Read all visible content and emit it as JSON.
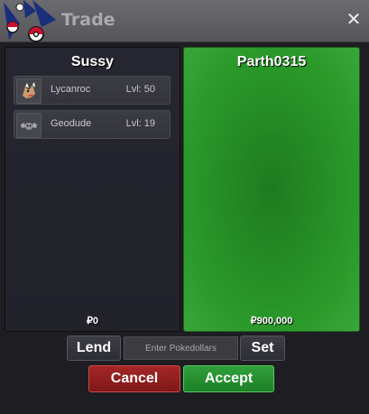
{
  "window": {
    "title": "Trade",
    "close_glyph": "✕"
  },
  "left_player": {
    "name": "Sussy",
    "money": "₽0",
    "pokemon": [
      {
        "name": "Lycanroc",
        "level": "Lvl: 50",
        "icon": "lycanroc-sprite-icon"
      },
      {
        "name": "Geodude",
        "level": "Lvl: 19",
        "icon": "geodude-sprite-icon"
      }
    ]
  },
  "right_player": {
    "name": "Parth0315",
    "money": "₽900,000"
  },
  "controls": {
    "lend_label": "Lend",
    "pokedollars_placeholder": "Enter Pokedollars",
    "set_label": "Set",
    "cancel_label": "Cancel",
    "accept_label": "Accept"
  },
  "colors": {
    "offer_panel_green": "#2a9a2a",
    "cancel_red": "#a52626",
    "accept_green": "#2fa03a",
    "title_text": "#a9a9ae"
  }
}
